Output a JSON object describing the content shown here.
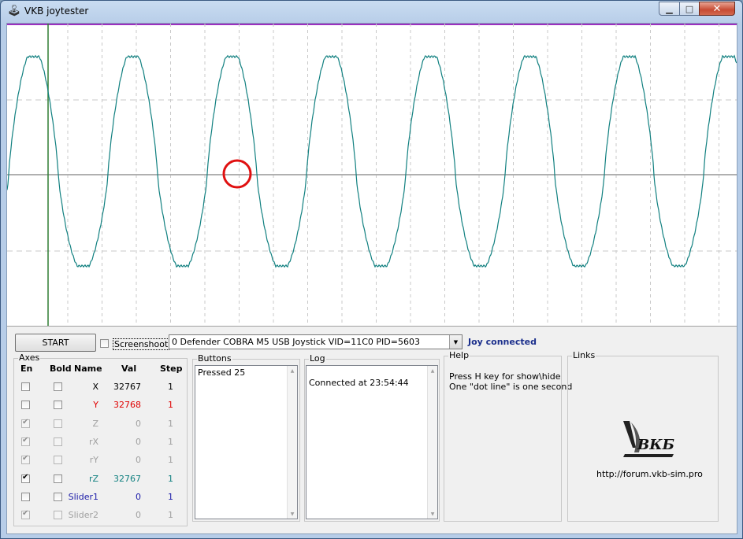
{
  "window": {
    "title": "VKB joytester",
    "icon": "joystick-icon"
  },
  "window_buttons": {
    "minimize": "▁",
    "maximize": "□",
    "close": "✕"
  },
  "controls": {
    "start_label": "START",
    "screenshot_label": "Screenshoot",
    "screenshot_checked": false,
    "device_selected": "0 Defender COBRA M5 USB Joystick VID=11C0 PID=5603",
    "status": "Joy connected",
    "status_color": "#1b2f8c"
  },
  "axes": {
    "title": "Axes",
    "headers": {
      "en": "En",
      "bold": "Bold",
      "name": "Name",
      "val": "Val",
      "step": "Step"
    },
    "rows": [
      {
        "name": "X",
        "val": "32767",
        "step": "1",
        "en": false,
        "bold": false,
        "enabled": true,
        "color": "#000000"
      },
      {
        "name": "Y",
        "val": "32768",
        "step": "1",
        "en": false,
        "bold": false,
        "enabled": true,
        "color": "#e00000"
      },
      {
        "name": "Z",
        "val": "0",
        "step": "1",
        "en": true,
        "bold": false,
        "enabled": false,
        "color": "#a0a0a0"
      },
      {
        "name": "rX",
        "val": "0",
        "step": "1",
        "en": true,
        "bold": false,
        "enabled": false,
        "color": "#a0a0a0"
      },
      {
        "name": "rY",
        "val": "0",
        "step": "1",
        "en": true,
        "bold": false,
        "enabled": false,
        "color": "#a0a0a0"
      },
      {
        "name": "rZ",
        "val": "32767",
        "step": "1",
        "en": true,
        "bold": false,
        "enabled": true,
        "color": "#118080"
      },
      {
        "name": "Slider1",
        "val": "0",
        "step": "1",
        "en": false,
        "bold": false,
        "enabled": true,
        "color": "#1a1aa8"
      },
      {
        "name": "Slider2",
        "val": "0",
        "step": "1",
        "en": true,
        "bold": false,
        "enabled": false,
        "color": "#a0a0a0"
      }
    ]
  },
  "buttons_panel": {
    "title": "Buttons",
    "items": [
      "Pressed 25"
    ]
  },
  "log_panel": {
    "title": "Log",
    "items": [
      "Connected at 23:54:44"
    ]
  },
  "help_panel": {
    "title": "Help",
    "lines": [
      "Press H key for show\\hide",
      "One \"dot line\" is one second"
    ]
  },
  "links_panel": {
    "title": "Links",
    "logo_text": "ВКБ",
    "url": "http://forum.vkb-sim.pro"
  },
  "graph": {
    "trace_color": "#118080",
    "marker_color": "#e01010",
    "top_line_color": "#9b30c0"
  }
}
